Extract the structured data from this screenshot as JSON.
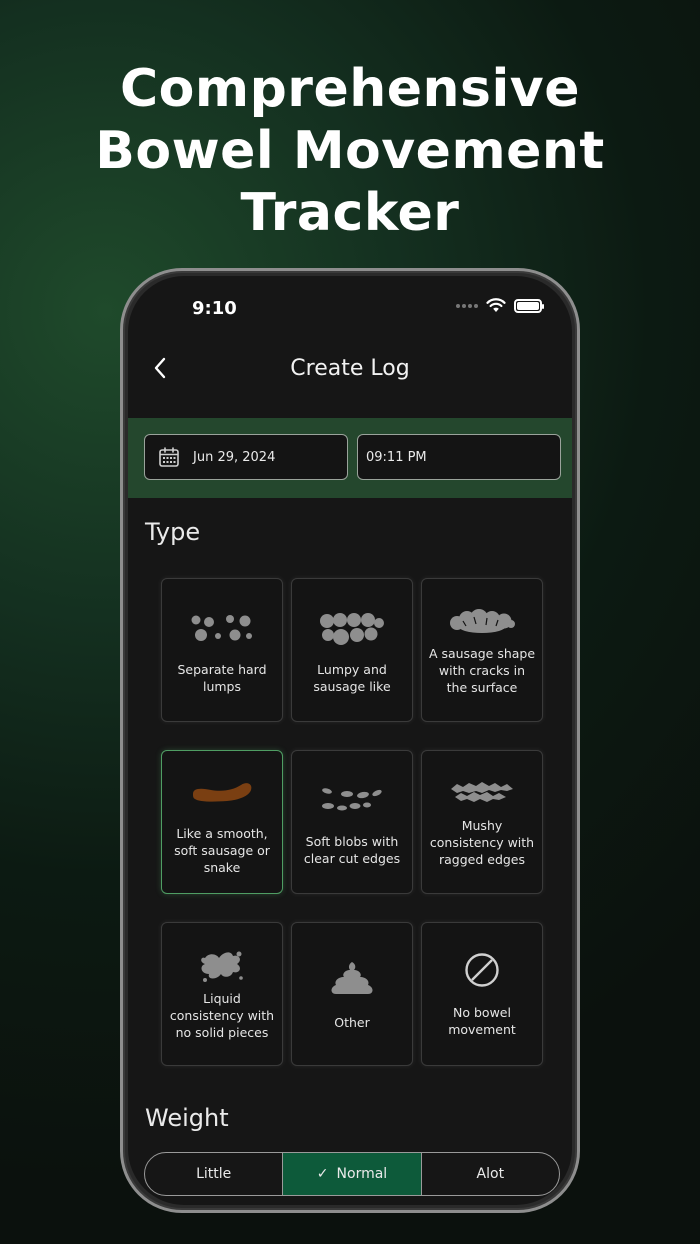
{
  "headline": {
    "line1": "Comprehensive",
    "line2": "Bowel Movement",
    "line3": "Tracker"
  },
  "status_bar": {
    "time": "9:10"
  },
  "nav": {
    "title": "Create Log"
  },
  "datetime": {
    "date": "Jun 29, 2024",
    "time": "09:11 PM"
  },
  "type_section": {
    "label": "Type",
    "options": [
      {
        "label": "Separate hard lumps",
        "icon": "separate-lumps-icon"
      },
      {
        "label": "Lumpy and sausage like",
        "icon": "lumpy-sausage-icon"
      },
      {
        "label": "A sausage shape with cracks in the surface",
        "icon": "cracked-sausage-icon"
      },
      {
        "label": "Like a smooth, soft sausage or snake",
        "icon": "smooth-sausage-icon",
        "selected": true
      },
      {
        "label": "Soft blobs with clear cut edges",
        "icon": "soft-blobs-icon"
      },
      {
        "label": "Mushy consistency with ragged edges",
        "icon": "mushy-icon"
      },
      {
        "label": "Liquid consistency with no solid pieces",
        "icon": "liquid-splash-icon"
      },
      {
        "label": "Other",
        "icon": "poop-icon"
      },
      {
        "label": "No bowel movement",
        "icon": "no-symbol-icon"
      }
    ]
  },
  "weight_section": {
    "label": "Weight",
    "options": [
      {
        "label": "Little",
        "active": false
      },
      {
        "label": "Normal",
        "active": true
      },
      {
        "label": "Alot",
        "active": false
      }
    ]
  },
  "colors": {
    "accent_green": "#0d5a3a",
    "datebar_green": "#24472d",
    "selected_border": "#4f9d63",
    "stool_brown": "#7a3f12",
    "icon_gray": "#8e8e8e"
  }
}
